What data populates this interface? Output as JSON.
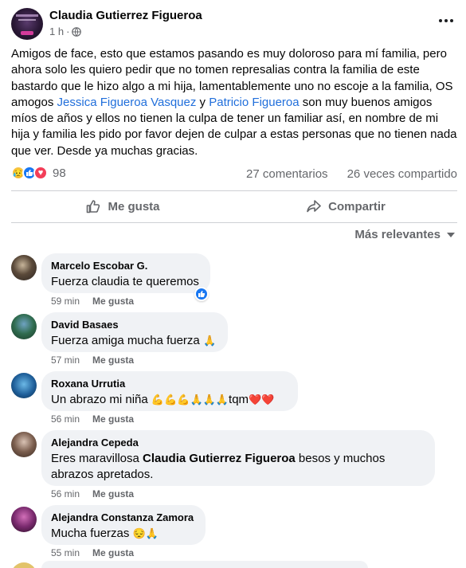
{
  "post": {
    "author": "Claudia Gutierrez Figueroa",
    "time": "1 h",
    "dot": "·",
    "text_part1": "Amigos de face, esto que estamos pasando es muy doloroso para mí familia, pero ahora solo les quiero pedir que no tomen represalias contra la familia de este bastardo que le hizo algo a mi hija, lamentablemente uno no escoje a la familia, OS amogos ",
    "mention1": "Jessica Figueroa Vasquez",
    "text_part2": " y ",
    "mention2": "Patricio Figueroa",
    "text_part3": "  son muy buenos amigos míos de años y ellos no tienen la culpa de tener un familiar así, en nombre de mi hija y familia les pido por favor dejen de culpar a estas personas que no tienen nada que ver. Desde ya muchas gracias.",
    "reaction_count": "98",
    "comments_count": "27 comentarios",
    "shares_count": "26 veces compartido"
  },
  "actions": {
    "like": "Me gusta",
    "share": "Compartir"
  },
  "sort_label": "Más relevantes",
  "comments": [
    {
      "name": "Marcelo Escobar G.",
      "text": "Fuerza claudia te queremos",
      "time": "59 min",
      "like": "Me gusta"
    },
    {
      "name": "David Basaes",
      "text": "Fuerza amiga mucha fuerza",
      "emoji": "🙏",
      "time": "57 min",
      "like": "Me gusta"
    },
    {
      "name": "Roxana Urrutia",
      "text": "Un abrazo mi niña ",
      "emoji": "💪💪💪🙏🙏🙏",
      "text2": "tqm",
      "hearts": "❤️❤️",
      "time": "56 min",
      "like": "Me gusta"
    },
    {
      "name": "Alejandra Cepeda",
      "text_a": "Eres maravillosa ",
      "text_bold": "Claudia Gutierrez Figueroa",
      "text_b": " besos y muchos",
      "text_c": "abrazos apretados.",
      "time": "56 min",
      "like": "Me gusta"
    },
    {
      "name": "Alejandra Constanza Zamora",
      "text": "Mucha fuerzas ",
      "emoji": "😔🙏",
      "time": "55 min",
      "like": "Me gusta"
    }
  ],
  "icons": {
    "globe": "globe-icon",
    "more": "more-options-icon",
    "like": "thumbs-up-icon",
    "share": "share-arrow-icon"
  },
  "colors": {
    "link": "#216fdb",
    "muted": "#65676b",
    "bubble": "#f0f2f5",
    "like_blue": "#1877f2",
    "love_red": "#f33e58"
  }
}
